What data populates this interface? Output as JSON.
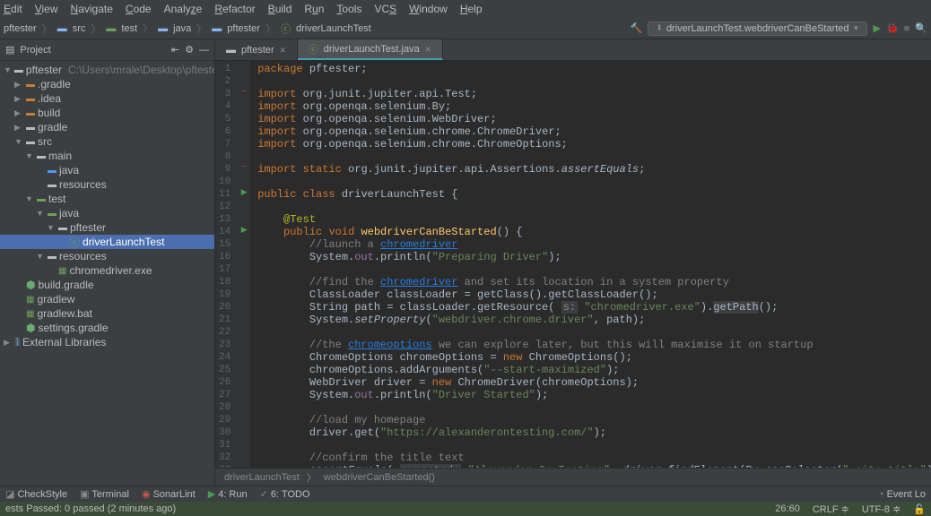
{
  "menubar": [
    "Edit",
    "View",
    "Navigate",
    "Code",
    "Analyze",
    "Refactor",
    "Build",
    "Run",
    "Tools",
    "VCS",
    "Window",
    "Help"
  ],
  "breadcrumb": {
    "root": "pftester",
    "items": [
      "src",
      "test",
      "java",
      "pftester",
      "driverLaunchTest"
    ]
  },
  "run": {
    "config": "driverLaunchTest.webdriverCanBeStarted"
  },
  "project": {
    "header": "Project",
    "root_name": "pftester",
    "root_path": "C:\\Users\\mrale\\Desktop\\pftester",
    "tree": {
      "gradle_dir": ".gradle",
      "idea_dir": ".idea",
      "build": "build",
      "gradle": "gradle",
      "src": "src",
      "main": "main",
      "java": "java",
      "resources": "resources",
      "test": "test",
      "pftester_pkg": "pftester",
      "driverLaunchTest": "driverLaunchTest",
      "chromedriver": "chromedriver.exe",
      "build_gradle": "build.gradle",
      "gradlew": "gradlew",
      "gradlew_bat": "gradlew.bat",
      "settings_gradle": "settings.gradle",
      "ext_libs": "External Libraries"
    }
  },
  "tabs": {
    "t1": "pftester",
    "t2": "driverLaunchTest.java"
  },
  "code": {
    "lines": [
      "package pftester;",
      "",
      "import org.junit.jupiter.api.Test;",
      "import org.openqa.selenium.By;",
      "import org.openqa.selenium.WebDriver;",
      "import org.openqa.selenium.chrome.ChromeDriver;",
      "import org.openqa.selenium.chrome.ChromeOptions;",
      "",
      "import static org.junit.jupiter.api.Assertions.assertEquals;",
      "",
      "public class driverLaunchTest {",
      "",
      "    @Test",
      "    public void webdriverCanBeStarted() {",
      "        //launch a chromedriver",
      "        System.out.println(\"Preparing Driver\");",
      "",
      "        //find the chromedriver and set its location in a system property",
      "        ClassLoader classLoader = getClass().getClassLoader();",
      "        String path = classLoader.getResource( s: \"chromedriver.exe\").getPath();",
      "        System.setProperty(\"webdriver.chrome.driver\", path);",
      "",
      "        //the chromeoptions we can explore later, but this will maximise it on startup",
      "        ChromeOptions chromeOptions = new ChromeOptions();",
      "        chromeOptions.addArguments(\"--start-maximized\");",
      "        WebDriver driver = new ChromeDriver(chromeOptions);",
      "        System.out.println(\"Driver Started\");",
      "",
      "        //load my homepage",
      "        driver.get(\"https://alexanderontesting.com/\");",
      "",
      "        //confirm the title text",
      "        assertEquals( expected: \"Alexander On Testing\", driver.findElement(By.cssSelector(\".site-title\")).getText());"
    ],
    "start_line": 1
  },
  "breadcrumbbar": {
    "b1": "driverLaunchTest",
    "b2": "webdriverCanBeStarted()"
  },
  "statusbar": {
    "checkstyle": "CheckStyle",
    "terminal": "Terminal",
    "sonarlint": "SonarLint",
    "run": "4: Run",
    "todo": "6: TODO",
    "eventlog": "Event Lo",
    "tests": "ests Passed: 0 passed (2 minutes ago)",
    "pos": "26:60",
    "crlf": "CRLF",
    "enc": "UTF-8"
  }
}
